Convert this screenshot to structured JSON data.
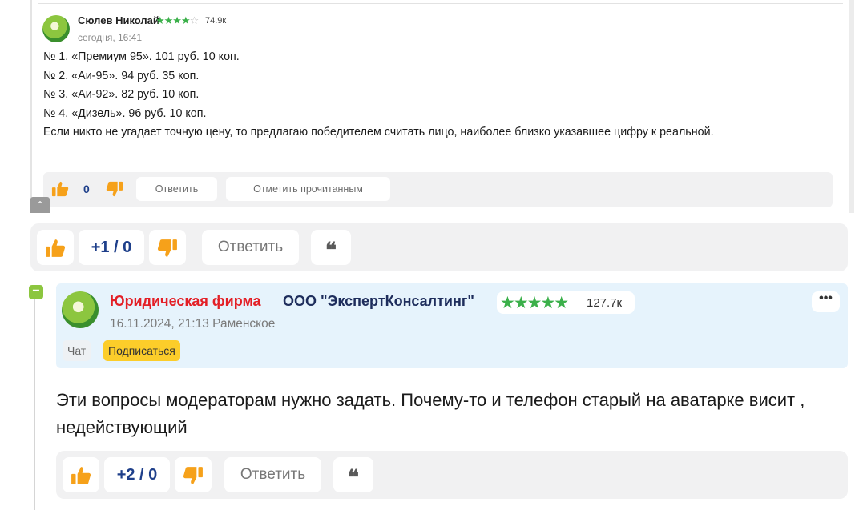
{
  "quoted_comment": {
    "author": "Сюлев Николай",
    "stars": "★★★★",
    "empty_stars": "☆",
    "rating": "74.9к",
    "time": "сегодня, 16:41",
    "lines": [
      "№ 1. «Премиум 95». 101 руб. 10 коп.",
      "№ 2. «Аи-95». 94 руб. 35 коп.",
      "№ 3. «Аи-92». 82 руб. 10 коп.",
      "№ 4. «Дизель». 96 руб. 10 коп.",
      "Если никто не угадает точную цену, то предлагаю победителем считать лицо, наиболее близко указавшее цифру к реальной."
    ],
    "vote_count": "0",
    "reply_label": "Ответить",
    "mark_read_label": "Отметить прочитанным",
    "accent_like": "#f6a11a"
  },
  "main_bar": {
    "score": "+1 / 0",
    "reply_label": "Ответить",
    "quote_glyph": "❝"
  },
  "comment": {
    "author_org_type": "Юридическая фирма",
    "author_name": "ООО \"ЭкспертКонсалтинг\"",
    "stars": "★★★★★",
    "rating": "127.7к",
    "meta": "16.11.2024, 21:13  Раменское",
    "chat_label": "Чат",
    "subscribe_label": "Подписаться",
    "more_glyph": "•••",
    "collapse_glyph": "−",
    "text": "Эти вопросы модераторам нужно задать. Почему-то и телефон старый на аватарке висит , недействующий",
    "score": "+2 / 0",
    "reply_label": "Ответить",
    "quote_glyph": "❝"
  },
  "colors": {
    "like": "#f6a11a",
    "score_text": "#1e3f8a",
    "org_red": "#e31f26",
    "star_green": "#3bb04a",
    "header_bg": "#e6f3fc",
    "subscribe_bg": "#fccd2a"
  }
}
